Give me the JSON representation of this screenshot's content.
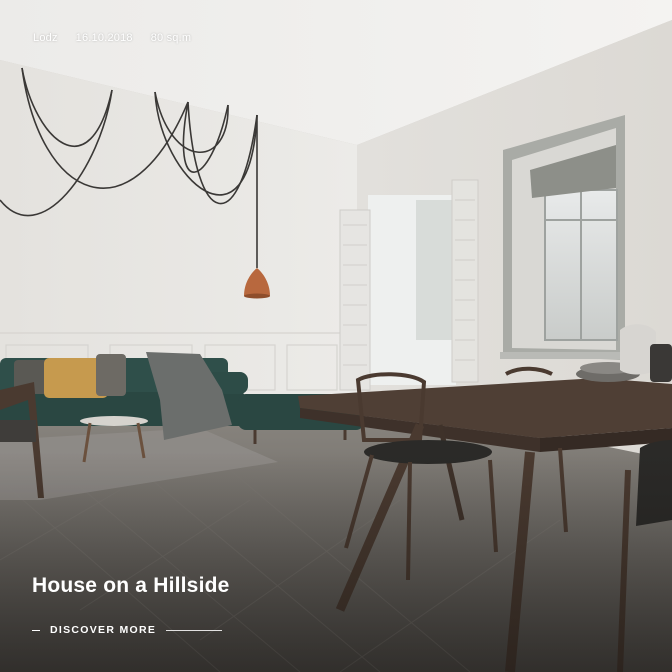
{
  "project": {
    "city": "Lodz",
    "date": "16.10.2018",
    "area": "80 sq.m",
    "title": "House on a Hillside",
    "cta_label": "DISCOVER MORE"
  },
  "image": {
    "subject": "interior photo: living room with green sofa, pendant lamp, dining table with chairs, herringbone wood floor"
  },
  "colors": {
    "text": "#ffffff",
    "wall": "#e9e7e3",
    "floor": "#6f6b66",
    "sofa": "#2f4f4a",
    "table": "#4a3a30",
    "lamp": "#b8683e"
  }
}
